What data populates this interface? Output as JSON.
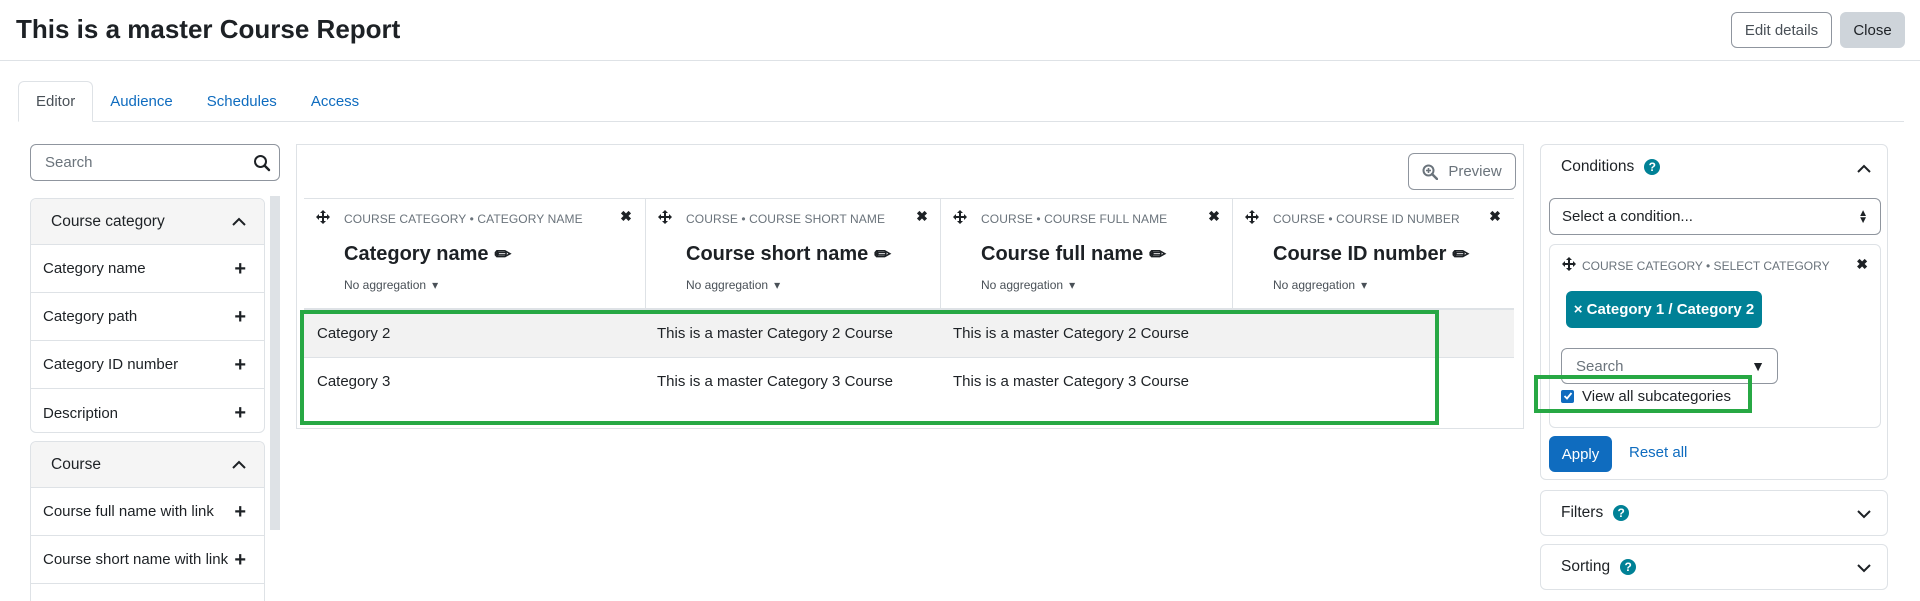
{
  "header": {
    "title": "This is a master Course Report",
    "edit_details_label": "Edit details",
    "close_label": "Close"
  },
  "tabs": [
    {
      "label": "Editor",
      "active": true
    },
    {
      "label": "Audience",
      "active": false
    },
    {
      "label": "Schedules",
      "active": false
    },
    {
      "label": "Access",
      "active": false
    }
  ],
  "sidebar": {
    "search": {
      "placeholder": "Search",
      "value": ""
    },
    "groups": [
      {
        "title": "Course category",
        "expanded": true,
        "items": [
          "Category name",
          "Category path",
          "Category ID number",
          "Description"
        ]
      },
      {
        "title": "Course",
        "expanded": true,
        "items": [
          "Course full name with link",
          "Course short name with link"
        ]
      }
    ]
  },
  "main": {
    "preview_label": "Preview",
    "columns": [
      {
        "category": "COURSE CATEGORY • CATEGORY NAME",
        "title": "Category name",
        "aggregation": "No aggregation"
      },
      {
        "category": "COURSE • COURSE SHORT NAME",
        "title": "Course short name",
        "aggregation": "No aggregation"
      },
      {
        "category": "COURSE • COURSE FULL NAME",
        "title": "Course full name",
        "aggregation": "No aggregation"
      },
      {
        "category": "COURSE • COURSE ID NUMBER",
        "title": "Course ID number",
        "aggregation": "No aggregation"
      }
    ],
    "rows": [
      [
        "Category 2",
        "This is a master Category 2 Course",
        "This is a master Category 2 Course",
        ""
      ],
      [
        "Category 3",
        "This is a master Category 3 Course",
        "This is a master Category 3 Course",
        ""
      ]
    ]
  },
  "conditions": {
    "title": "Conditions",
    "select_placeholder": "Select a condition...",
    "condition_label": "COURSE CATEGORY • SELECT CATEGORY",
    "chip_label": "× Category 1 / Category 2",
    "search_placeholder": "Search",
    "checkbox_label": "View all subcategories",
    "checkbox_checked": true,
    "apply_label": "Apply",
    "reset_label": "Reset all"
  },
  "filters": {
    "title": "Filters"
  },
  "sorting": {
    "title": "Sorting"
  },
  "colors": {
    "link": "#0f6cbf",
    "teal": "#008196",
    "highlight": "#27a844"
  }
}
